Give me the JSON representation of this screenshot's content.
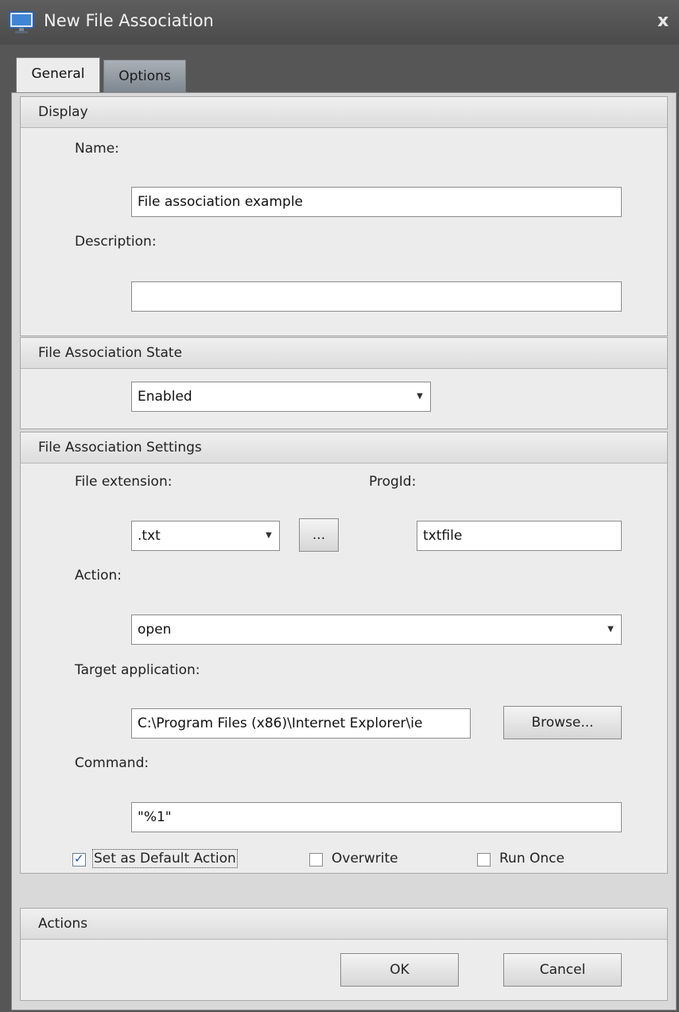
{
  "window": {
    "title": "New File Association",
    "close_glyph": "x"
  },
  "tabs": [
    {
      "label": "General",
      "active": true
    },
    {
      "label": "Options",
      "active": false
    }
  ],
  "display": {
    "header": "Display",
    "name_label": "Name:",
    "name_value": "File association example",
    "description_label": "Description:",
    "description_value": ""
  },
  "state": {
    "header": "File Association State",
    "selected": "Enabled"
  },
  "settings": {
    "header": "File Association Settings",
    "file_extension_label": "File extension:",
    "file_extension_value": ".txt",
    "ellipsis_label": "...",
    "progid_label": "ProgId:",
    "progid_value": "txtfile",
    "action_label": "Action:",
    "action_value": "open",
    "target_label": "Target application:",
    "target_value": "C:\\Program Files (x86)\\Internet Explorer\\ie",
    "browse_label": "Browse...",
    "command_label": "Command:",
    "command_value": "\"%1\"",
    "default_action": {
      "label": "Set as Default Action",
      "checked": true
    },
    "overwrite": {
      "label": "Overwrite",
      "checked": false
    },
    "run_once": {
      "label": "Run Once",
      "checked": false
    }
  },
  "actions": {
    "header": "Actions",
    "ok_label": "OK",
    "cancel_label": "Cancel"
  },
  "icons": {
    "app": "monitor-icon",
    "dropdown": "chevron-down-icon"
  },
  "colors": {
    "title_bar": "#4f4f4f",
    "panel": "#ececec",
    "tab_inactive": "#8a939c"
  }
}
